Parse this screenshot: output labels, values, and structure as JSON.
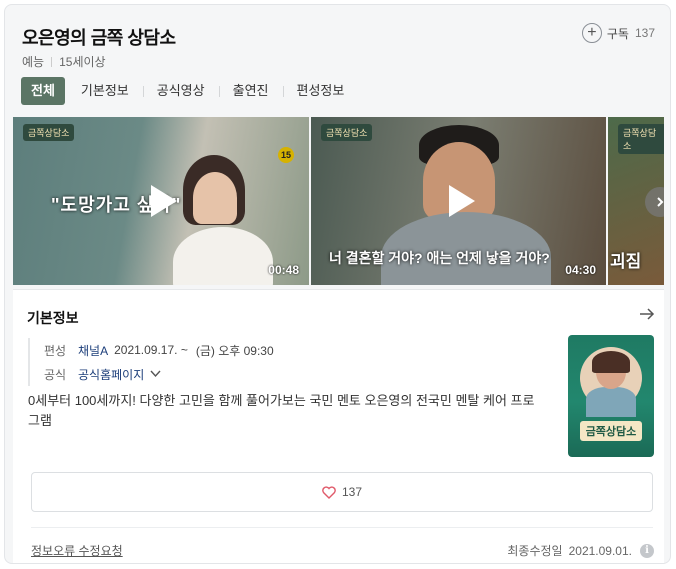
{
  "header": {
    "title": "오은영의 금쪽 상담소",
    "genre": "예능",
    "rating": "15세이상",
    "subscribe_label": "구독",
    "subscribe_count": "137"
  },
  "tabs": [
    {
      "label": "전체",
      "active": true
    },
    {
      "label": "기본정보"
    },
    {
      "label": "공식영상"
    },
    {
      "label": "출연진"
    },
    {
      "label": "편성정보"
    }
  ],
  "videos": [
    {
      "duration": "00:48",
      "caption": "\"도망가고 싶다\"",
      "show_logo": "금쪽상담소",
      "age_badge": "15"
    },
    {
      "duration": "04:30",
      "caption": "너 결혼할 거야? 애는 언제 낳을 거야?",
      "show_logo": "금쪽상담소"
    },
    {
      "caption": "괴짐",
      "show_logo": "금쪽상담소"
    }
  ],
  "info": {
    "section_title": "기본정보",
    "schedule_key": "편성",
    "channel": "채널A",
    "start_date": "2021.09.17. ~",
    "airtime": "(금) 오후 09:30",
    "official_key": "공식",
    "official_link": "공식홈페이지",
    "description": "0세부터 100세까지! 다양한 고민을 함께 풀어가보는 국민 멘토 오은영의 전국민 멘탈 케어 프로그램",
    "poster_title": "금쪽상담소",
    "like_count": "137",
    "report_label": "정보오류 수정요청",
    "updated_label": "최종수정일",
    "updated_date": "2021.09.01."
  },
  "colors": {
    "tab_active": "#5b7565",
    "link": "#1c3e7a",
    "heart": "#e05a6a"
  }
}
